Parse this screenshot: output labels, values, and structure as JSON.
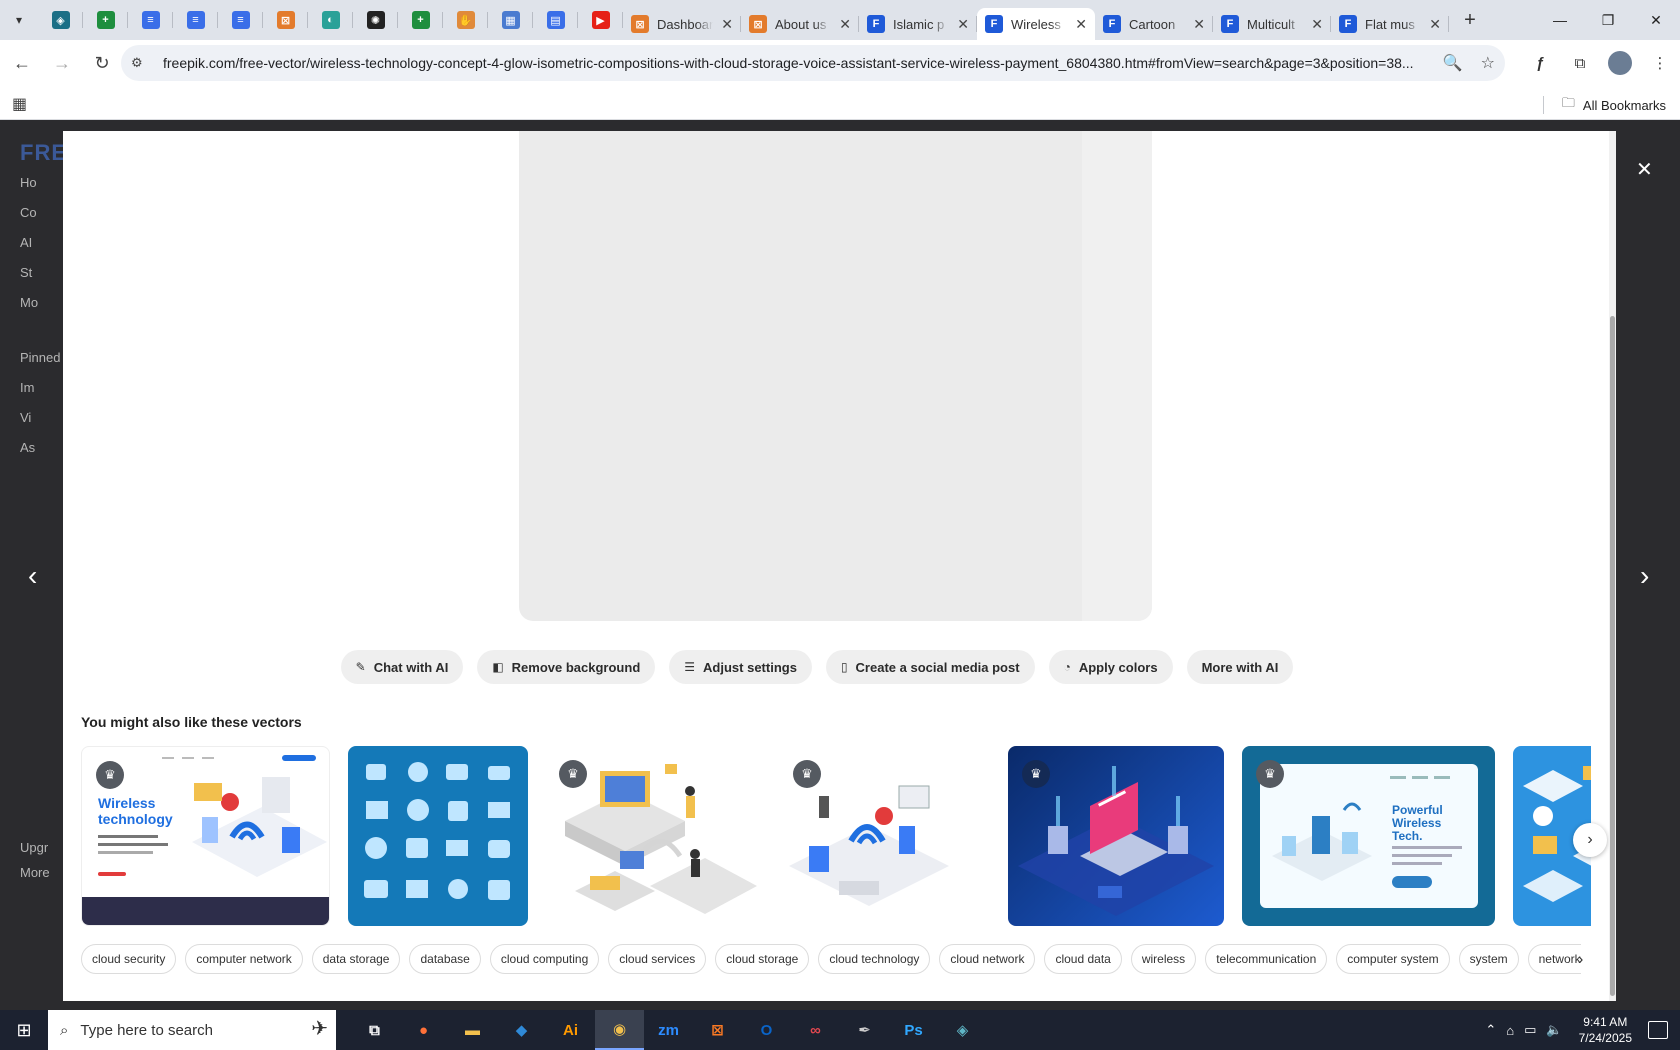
{
  "browser": {
    "pinned_tabs": [
      {
        "icon": "vpn-shield-icon",
        "color": "#1b6f86"
      },
      {
        "icon": "sheets-icon",
        "color": "#1e8e3e"
      },
      {
        "icon": "docs-icon",
        "color": "#3a6ee8"
      },
      {
        "icon": "docs-icon",
        "color": "#3a6ee8"
      },
      {
        "icon": "docs-icon",
        "color": "#3a6ee8"
      },
      {
        "icon": "xampp-icon",
        "color": "#e37b2c"
      },
      {
        "icon": "arc-icon",
        "color": "#2aa198"
      },
      {
        "icon": "openai-icon",
        "color": "#222222"
      },
      {
        "icon": "sheets-icon",
        "color": "#1e8e3e"
      },
      {
        "icon": "hand-icon",
        "color": "#e08a3a"
      },
      {
        "icon": "calculator-icon",
        "color": "#4a7bd0"
      },
      {
        "icon": "forms-icon",
        "color": "#3a6ee8"
      },
      {
        "icon": "youtube-icon",
        "color": "#e62117"
      }
    ],
    "tabs": [
      {
        "title": "Dashboard",
        "icon": "xampp-icon",
        "color": "#e37b2c",
        "active": false
      },
      {
        "title": "About us",
        "icon": "xampp-icon",
        "color": "#e37b2c",
        "active": false
      },
      {
        "title": "Islamic p",
        "icon": "freepik-icon",
        "color": "#1f5ad8",
        "active": false
      },
      {
        "title": "Wireless",
        "icon": "freepik-icon",
        "color": "#1f5ad8",
        "active": true
      },
      {
        "title": "Cartoon",
        "icon": "freepik-icon",
        "color": "#1f5ad8",
        "active": false
      },
      {
        "title": "Multicult",
        "icon": "freepik-icon",
        "color": "#1f5ad8",
        "active": false
      },
      {
        "title": "Flat mus",
        "icon": "freepik-icon",
        "color": "#1f5ad8",
        "active": false
      }
    ],
    "url": "freepik.com/free-vector/wireless-technology-concept-4-glow-isometric-compositions-with-cloud-storage-voice-assistant-service-wireless-payment_6804380.htm#fromView=search&page=3&position=38...",
    "bookmarks_label": "All Bookmarks"
  },
  "page_behind": {
    "brand": "FRE",
    "side_items": [
      "Ho",
      "Co",
      "AI",
      "St",
      "Mo",
      "Pinned",
      "Im",
      "Vi",
      "As",
      "Upgr",
      "More"
    ]
  },
  "modal": {
    "actions": [
      {
        "label": "Chat with AI",
        "icon": "chat-ai-icon"
      },
      {
        "label": "Remove background",
        "icon": "remove-bg-icon"
      },
      {
        "label": "Adjust settings",
        "icon": "sliders-icon"
      },
      {
        "label": "Create a social media post",
        "icon": "phone-icon"
      },
      {
        "label": "Apply colors",
        "icon": "palette-icon"
      },
      {
        "label": "More with AI",
        "icon": ""
      }
    ],
    "related_title": "You might also like these vectors",
    "thumbnails": [
      {
        "kind": "landing",
        "heading": "Wireless technology",
        "premium": true,
        "bg": "#ffffff"
      },
      {
        "kind": "icons-grid",
        "premium": false,
        "bg": "#1479b8"
      },
      {
        "kind": "isometric-white",
        "premium": true,
        "bg": "#ffffff"
      },
      {
        "kind": "isometric-white-2",
        "premium": true,
        "bg": "#ffffff"
      },
      {
        "kind": "laptop-dark",
        "premium": true,
        "bg": "#1a3f8f"
      },
      {
        "kind": "landing-blue",
        "heading": "Powerful Wireless Tech.",
        "premium": true,
        "bg": "#136a96"
      },
      {
        "kind": "isometric-blue",
        "premium": false,
        "bg": "#2d93e0"
      }
    ],
    "tags": [
      "cloud security",
      "computer network",
      "data storage",
      "database",
      "cloud computing",
      "cloud services",
      "cloud storage",
      "cloud technology",
      "cloud network",
      "cloud data",
      "wireless",
      "telecommunication",
      "computer system",
      "system",
      "network security"
    ]
  },
  "taskbar": {
    "search_placeholder": "Type here to search",
    "apps": [
      {
        "icon": "task-view-icon",
        "active": false
      },
      {
        "icon": "firefox-icon",
        "active": false
      },
      {
        "icon": "file-explorer-icon",
        "active": false
      },
      {
        "icon": "vscode-icon",
        "active": false
      },
      {
        "icon": "illustrator-icon",
        "active": false
      },
      {
        "icon": "chrome-icon",
        "active": true
      },
      {
        "icon": "zoom-icon",
        "active": false
      },
      {
        "icon": "xampp-icon",
        "active": false
      },
      {
        "icon": "outlook-icon",
        "active": false
      },
      {
        "icon": "creative-cloud-icon",
        "active": false
      },
      {
        "icon": "pen-tool-icon",
        "active": false
      },
      {
        "icon": "photoshop-icon",
        "active": false
      },
      {
        "icon": "app-icon",
        "active": false
      }
    ],
    "time": "9:41 AM",
    "date": "7/24/2025"
  }
}
